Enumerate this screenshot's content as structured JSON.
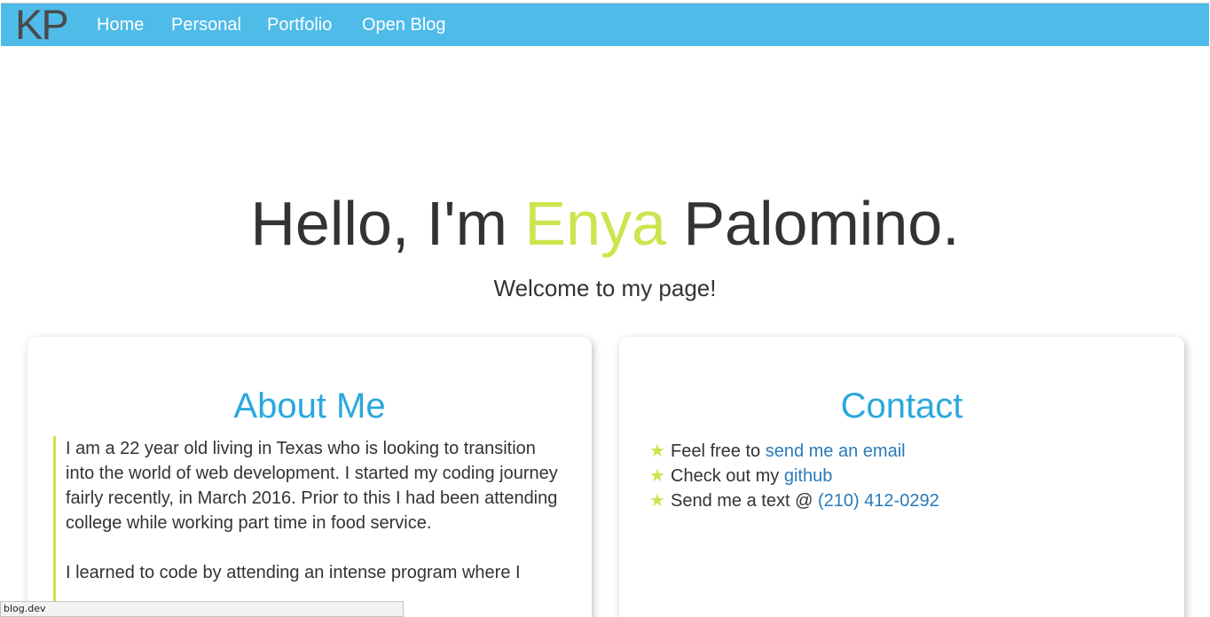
{
  "navbar": {
    "brand": "KP",
    "links": [
      {
        "label": "Home"
      },
      {
        "label": "Personal"
      },
      {
        "label": "Portfolio"
      },
      {
        "label": "Open Blog"
      }
    ],
    "background_color": "#4fbbe9"
  },
  "hero": {
    "greeting": "Hello, I'm ",
    "first_name": "Enya",
    "last_name": " Palomino.",
    "subtitle": "Welcome to my page!",
    "accent_color": "#cde44f"
  },
  "about": {
    "title": "About Me",
    "paragraphs": [
      "I am a 22 year old living in Texas who is looking to transition into the world of web development. I started my coding journey fairly recently, in March 2016. Prior to this I had been attending college while working part time in food service.",
      "I learned to code by attending an intense program where I"
    ]
  },
  "contact": {
    "title": "Contact",
    "icon": "star-icon",
    "items": [
      {
        "text": "Feel free to ",
        "link": "send me an email"
      },
      {
        "text": "Check out my ",
        "link": "github"
      },
      {
        "text": "Send me a text @ ",
        "link": "(210) 412-0292"
      }
    ]
  },
  "status_bar": {
    "url": "blog.dev"
  },
  "colors": {
    "heading": "#2aa8de",
    "link": "#2a7ab8",
    "text": "#333333"
  }
}
